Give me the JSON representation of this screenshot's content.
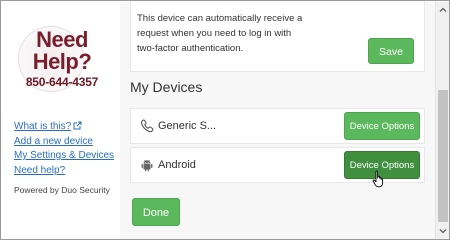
{
  "sidebar": {
    "logo": {
      "line1": "Need",
      "line2": "Help?",
      "phone": "850-644-4357"
    },
    "links": [
      {
        "label": "What is this?",
        "external": true
      },
      {
        "label": "Add a new device"
      },
      {
        "label": "My Settings & Devices"
      },
      {
        "label": "Need help?"
      }
    ],
    "powered_by": "Powered by Duo Security"
  },
  "auto_push": {
    "description": "This device can automatically receive a request when you need to log in with two-factor authentication.",
    "save_label": "Save"
  },
  "devices": {
    "title": "My Devices",
    "items": [
      {
        "name": "Generic S...",
        "icon": "phone-icon",
        "button": "Device Options"
      },
      {
        "name": "Android",
        "icon": "android-icon",
        "button": "Device Options"
      }
    ]
  },
  "done_label": "Done",
  "colors": {
    "accent_green": "#5cb85c",
    "accent_green_active": "#3f8f3f",
    "link_blue": "#2a6fbf",
    "brand_maroon": "#7a1e2e"
  }
}
